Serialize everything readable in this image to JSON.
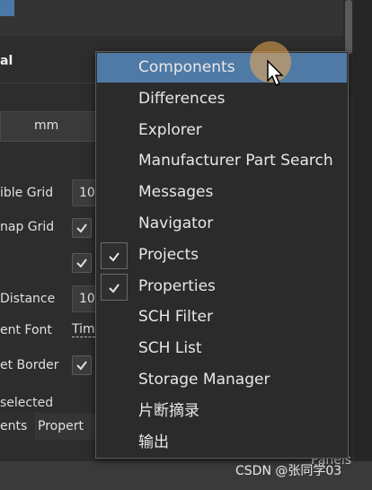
{
  "panel": {
    "title": "al",
    "unit": "mm",
    "properties": [
      {
        "label": "ible Grid",
        "value": "10"
      },
      {
        "label": "nap Grid",
        "value": ""
      },
      {
        "label": "",
        "value": ""
      },
      {
        "label": "Distance",
        "value": "10"
      },
      {
        "label": "ent Font",
        "value": "Tim"
      },
      {
        "label": "et Border",
        "value": ""
      }
    ],
    "selection_text": "selected",
    "tabs": [
      "ents",
      "Propert"
    ],
    "panels_button": "Panels"
  },
  "menu": {
    "items": [
      {
        "label": "Components",
        "checked": false,
        "highlighted": true
      },
      {
        "label": "Differences",
        "checked": false,
        "highlighted": false
      },
      {
        "label": "Explorer",
        "checked": false,
        "highlighted": false
      },
      {
        "label": "Manufacturer Part Search",
        "checked": false,
        "highlighted": false
      },
      {
        "label": "Messages",
        "checked": false,
        "highlighted": false
      },
      {
        "label": "Navigator",
        "checked": false,
        "highlighted": false
      },
      {
        "label": "Projects",
        "checked": true,
        "highlighted": false
      },
      {
        "label": "Properties",
        "checked": true,
        "highlighted": false
      },
      {
        "label": "SCH Filter",
        "checked": false,
        "highlighted": false
      },
      {
        "label": "SCH List",
        "checked": false,
        "highlighted": false
      },
      {
        "label": "Storage Manager",
        "checked": false,
        "highlighted": false
      },
      {
        "label": "片断摘录",
        "checked": false,
        "highlighted": false
      },
      {
        "label": "输出",
        "checked": false,
        "highlighted": false
      }
    ]
  },
  "watermark": "CSDN @张同学03",
  "colors": {
    "highlight": "#4f7aa6",
    "menu_bg": "#2b2b2b",
    "panel_bg": "#2d2d2d"
  }
}
